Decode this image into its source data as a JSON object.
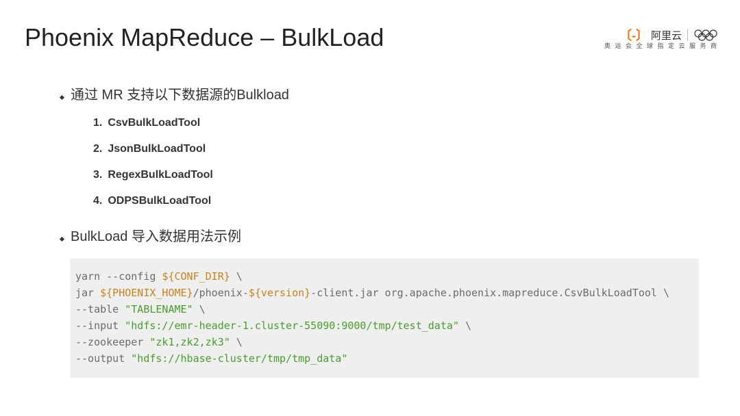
{
  "title": "Phoenix MapReduce – BulkLoad",
  "logo": {
    "brand": "阿里云",
    "tagline": "奥 运 会 全 球 指 定 云 服 务 商"
  },
  "section1": {
    "heading": "通过 MR 支持以下数据源的Bulkload",
    "tools": [
      {
        "num": "1.",
        "name": "CsvBulkLoadTool"
      },
      {
        "num": "2.",
        "name": "JsonBulkLoadTool"
      },
      {
        "num": "3.",
        "name": "RegexBulkLoadTool"
      },
      {
        "num": "4.",
        "name": "ODPSBulkLoadTool"
      }
    ]
  },
  "section2": {
    "heading": "BulkLoad 导入数据用法示例"
  },
  "code": {
    "l1a": "yarn --config ",
    "l1v": "${CONF_DIR}",
    "l1b": " \\",
    "l2a": "jar ",
    "l2v1": "${PHOENIX_HOME}",
    "l2b": "/phoenix-",
    "l2v2": "${version}",
    "l2c": "-client.jar org.apache.phoenix.mapreduce.CsvBulkLoadTool \\",
    "l3a": "--table ",
    "l3s": "\"TABLENAME\"",
    "l3b": " \\",
    "l4a": "--input ",
    "l4s": "\"hdfs://emr-header-1.cluster-55090:9000/tmp/test_data\"",
    "l4b": " \\",
    "l5a": "--zookeeper ",
    "l5s": "\"zk1,zk2,zk3\"",
    "l5b": " \\",
    "l6a": "--output ",
    "l6s": "\"hdfs://hbase-cluster/tmp/tmp_data\""
  }
}
